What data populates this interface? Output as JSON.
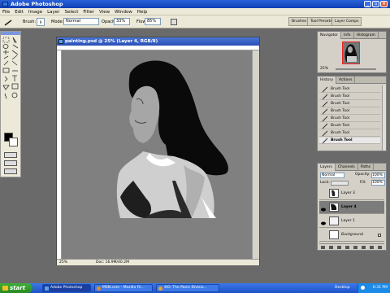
{
  "window": {
    "title": "Adobe Photoshop"
  },
  "menu": [
    "File",
    "Edit",
    "Image",
    "Layer",
    "Select",
    "Filter",
    "View",
    "Window",
    "Help"
  ],
  "options": {
    "brush_label": "Brush:",
    "brush_size": "9",
    "mode_label": "Mode:",
    "mode_value": "Normal",
    "opacity_label": "Opacity:",
    "opacity_value": "33%",
    "flow_label": "Flow:",
    "flow_value": "85%",
    "wells": [
      "Brushes",
      "Tool Presets",
      "Layer Comps"
    ]
  },
  "document": {
    "title": "painting.psd @ 25% (Layer 4, RGB/8)",
    "zoom": "25%",
    "doc_info": "Doc: 16.9M/40.2M"
  },
  "navigator": {
    "tabs": [
      "Navigator",
      "Info",
      "Histogram"
    ],
    "zoom": "25%"
  },
  "history": {
    "tabs": [
      "History",
      "Actions"
    ],
    "items": [
      "Brush Tool",
      "Brush Tool",
      "Brush Tool",
      "Brush Tool",
      "Brush Tool",
      "Brush Tool",
      "Brush Tool",
      "Brush Tool"
    ]
  },
  "layers": {
    "tabs": [
      "Layers",
      "Channels",
      "Paths"
    ],
    "blend": "Normal",
    "opacity_label": "Opacity:",
    "opacity": "100%",
    "lock_label": "Lock:",
    "fill_label": "Fill:",
    "fill": "100%",
    "items": [
      {
        "name": "Layer 3"
      },
      {
        "name": "Layer 4"
      },
      {
        "name": "Layer 1"
      },
      {
        "name": "Background"
      }
    ]
  },
  "taskbar": {
    "start": "start",
    "items": [
      "Adobe Photoshop",
      "MSN.com - Mozilla Fir...",
      "4IO. The Panic Divisio..."
    ],
    "lang": "Desktop",
    "time": "6:31 PM"
  },
  "colors": {
    "titlebar": "#0f3fb5",
    "taskbar": "#1e52c8",
    "canvas": "#808080",
    "selected_layer": "#7c7c7c"
  }
}
